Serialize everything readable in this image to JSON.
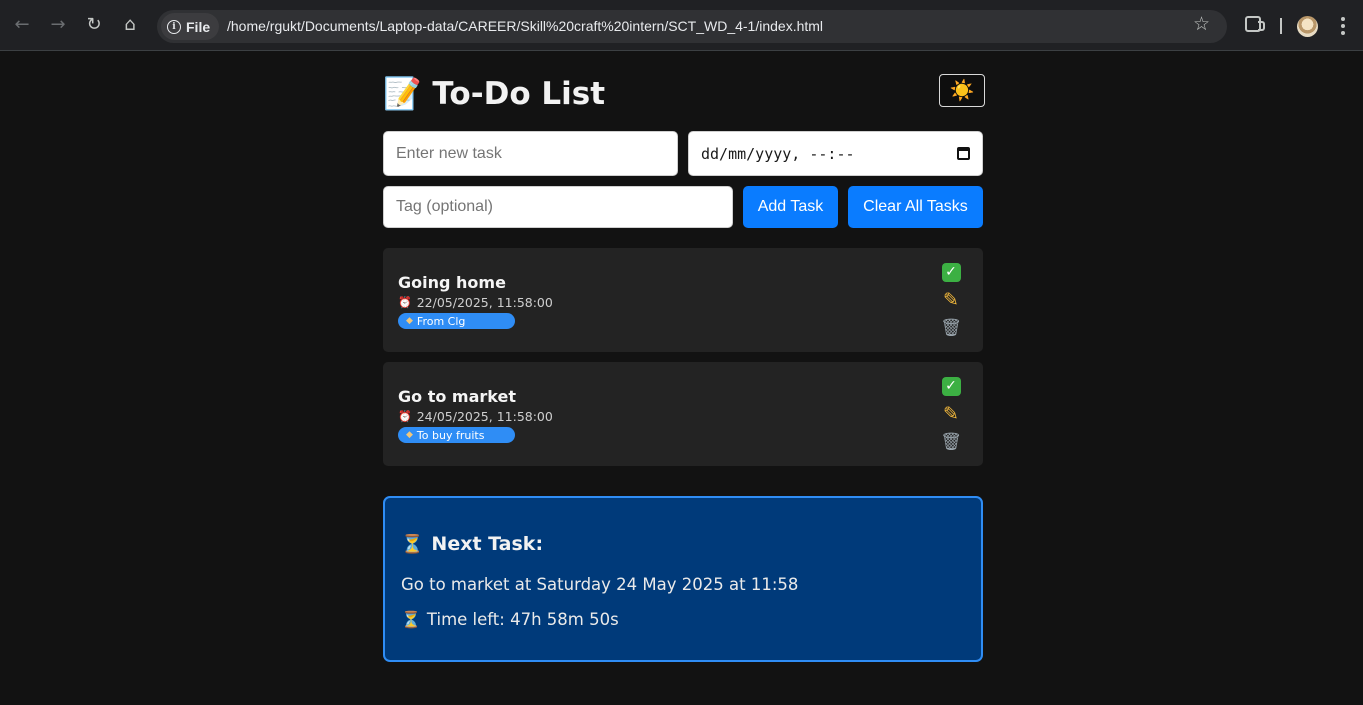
{
  "browser": {
    "chip_label": "File",
    "url": "/home/rgukt/Documents/Laptop-data/CAREER/Skill%20craft%20intern/SCT_WD_4-1/index.html",
    "back_icon": "arrow-left",
    "forward_icon": "arrow-right",
    "reload_icon": "reload",
    "home_icon": "home"
  },
  "app": {
    "title_emoji": "📝",
    "title": "To-Do List",
    "theme_toggle": "☀️"
  },
  "form": {
    "task_placeholder": "Enter new task",
    "datetime_placeholder": "dd/mm/yyyy, --:--",
    "tag_placeholder": "Tag (optional)",
    "add_label": "Add Task",
    "clear_label": "Clear All Tasks"
  },
  "tasks": [
    {
      "title": "Going home",
      "due": "22/05/2025, 11:58:00",
      "tag": "From Clg"
    },
    {
      "title": "Go to market",
      "due": "24/05/2025, 11:58:00",
      "tag": "To buy fruits"
    }
  ],
  "next_task": {
    "heading": "Next Task:",
    "description": "Go to market at Saturday 24 May 2025 at 11:58",
    "time_left": "Time left: 47h 58m 50s"
  },
  "colors": {
    "accent": "#0a7cff",
    "next_box_bg": "#003a7a",
    "next_box_border": "#2f8df5",
    "card_bg": "#232323",
    "page_bg": "#121212"
  }
}
